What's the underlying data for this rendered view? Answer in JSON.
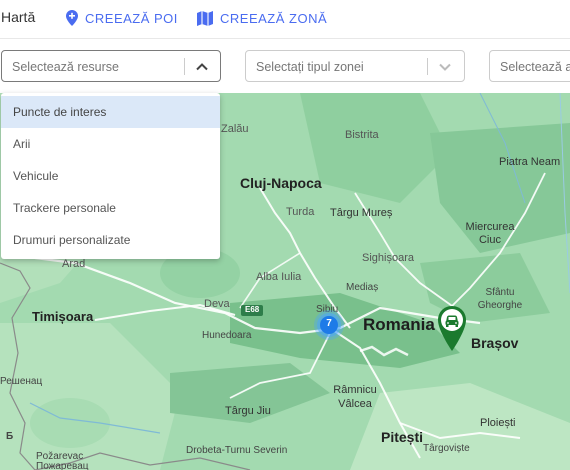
{
  "header": {
    "title": "Hartă",
    "create_poi_label": "CREEAZĂ POI",
    "create_zone_label": "CREEAZĂ ZONĂ",
    "accent_color": "#4a6cf0"
  },
  "filters": {
    "resources_placeholder": "Selectează resurse",
    "zone_type_placeholder": "Selectați tipul zonei",
    "third_placeholder": "Selectează ar"
  },
  "dropdown": {
    "items": [
      {
        "label": "Puncte de interes"
      },
      {
        "label": "Arii"
      },
      {
        "label": "Vehicule"
      },
      {
        "label": "Trackere personale"
      },
      {
        "label": "Drumuri personalizate"
      }
    ]
  },
  "map": {
    "cluster_count": "7",
    "road_label": "E68",
    "cities": {
      "zalau": "Zalău",
      "bistrita": "Bistrita",
      "cluj": "Cluj-Napoca",
      "piatra": "Piatra Neam",
      "turda": "Turda",
      "targu_mures": "Târgu Mureș",
      "miercurea": "Miercurea Ciuc",
      "arad": "Arad",
      "sighisoara": "Sighișoara",
      "alba": "Alba Iulia",
      "medias": "Mediaș",
      "sfantu": "Sfântu Gheorghe",
      "deva": "Deva",
      "hunedoara": "Hunedoara",
      "sibiu": "Sibiu",
      "romania": "Romania",
      "timisoara": "Timișoara",
      "brasov": "Brașov",
      "resita_cyr": "Решенац",
      "rimnicu": "Râmnicu Vâlcea",
      "targu_jiu": "Târgu Jiu",
      "pitesti": "Pitești",
      "ploiesti": "Ploiești",
      "targoviste": "Târgoviște",
      "pozarevac": "Požarevac",
      "pozarevac_cyr": "Пожаревац",
      "drobeta": "Drobeta-Turnu Severin"
    }
  }
}
